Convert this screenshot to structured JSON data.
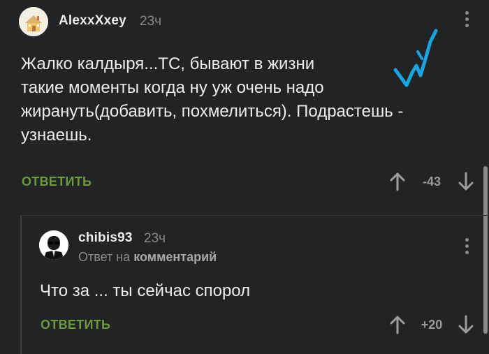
{
  "comments": [
    {
      "username": "AlexxXxey",
      "time": "23ч",
      "avatar_icon": "cottage-avatar-icon",
      "text_lines": [
        "Жалко калдыря...ТС, бывают в жизни",
        "такие моменты когда ну уж очень надо",
        "жирануть(добавить, похмелиться). Подрастешь -",
        "узнаешь."
      ],
      "reply_label": "ОТВЕТИТЬ",
      "rating": "-43",
      "upvote_icon": "arrow-up-icon",
      "downvote_icon": "arrow-down-icon",
      "more_icon": "more-vertical-icon"
    },
    {
      "username": "chibis93",
      "time": "23ч",
      "avatar_icon": "person-sunglasses-avatar-icon",
      "reply_to_prefix": "Ответ на",
      "reply_to_link": "комментарий",
      "text": "Что за ... ты сейчас спорол",
      "reply_label": "ОТВЕТИТЬ",
      "rating": "+20",
      "upvote_icon": "arrow-up-icon",
      "downvote_icon": "arrow-down-icon",
      "more_icon": "more-vertical-icon"
    }
  ],
  "colors": {
    "background": "#222325",
    "text": "#ececec",
    "muted": "#8a8a8a",
    "reply_green": "#6c9a3e",
    "annotation_blue": "#1aa5e0"
  },
  "annotation_icon": "blue-handwritten-mark-icon"
}
